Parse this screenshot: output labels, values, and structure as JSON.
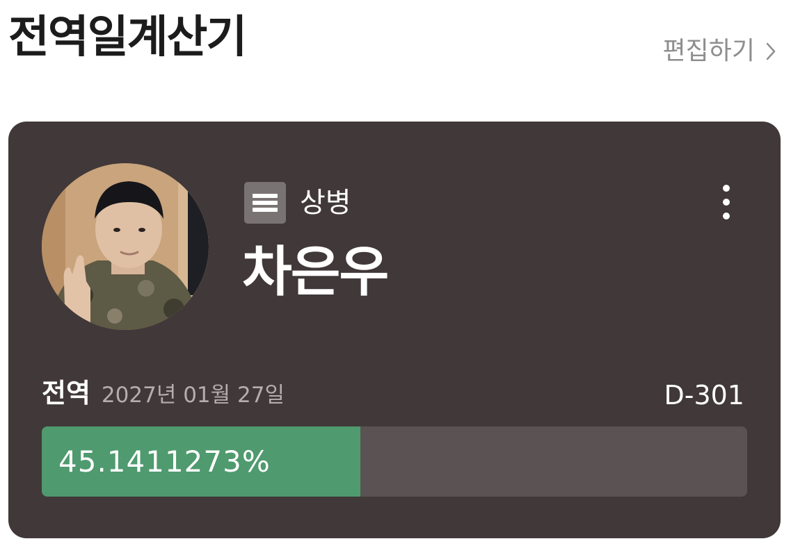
{
  "header": {
    "title": "전역일계산기",
    "edit_label": "편집하기",
    "edit_icon": "chevron-right-icon"
  },
  "soldier": {
    "avatar_icon": "profile-photo",
    "rank_icon": "rank-stripes-icon",
    "rank": "상병",
    "name": "차은우",
    "menu_icon": "more-vertical-icon"
  },
  "discharge": {
    "label": "전역",
    "date": "2027년 01월 27일",
    "dday": "D-301"
  },
  "progress": {
    "text": "45.1411273%",
    "value": 45.1411273
  },
  "colors": {
    "card_background": "#413839",
    "progress_fill": "#4f9a6e",
    "progress_track": "#5a5253",
    "badge_background": "#7a7374"
  }
}
